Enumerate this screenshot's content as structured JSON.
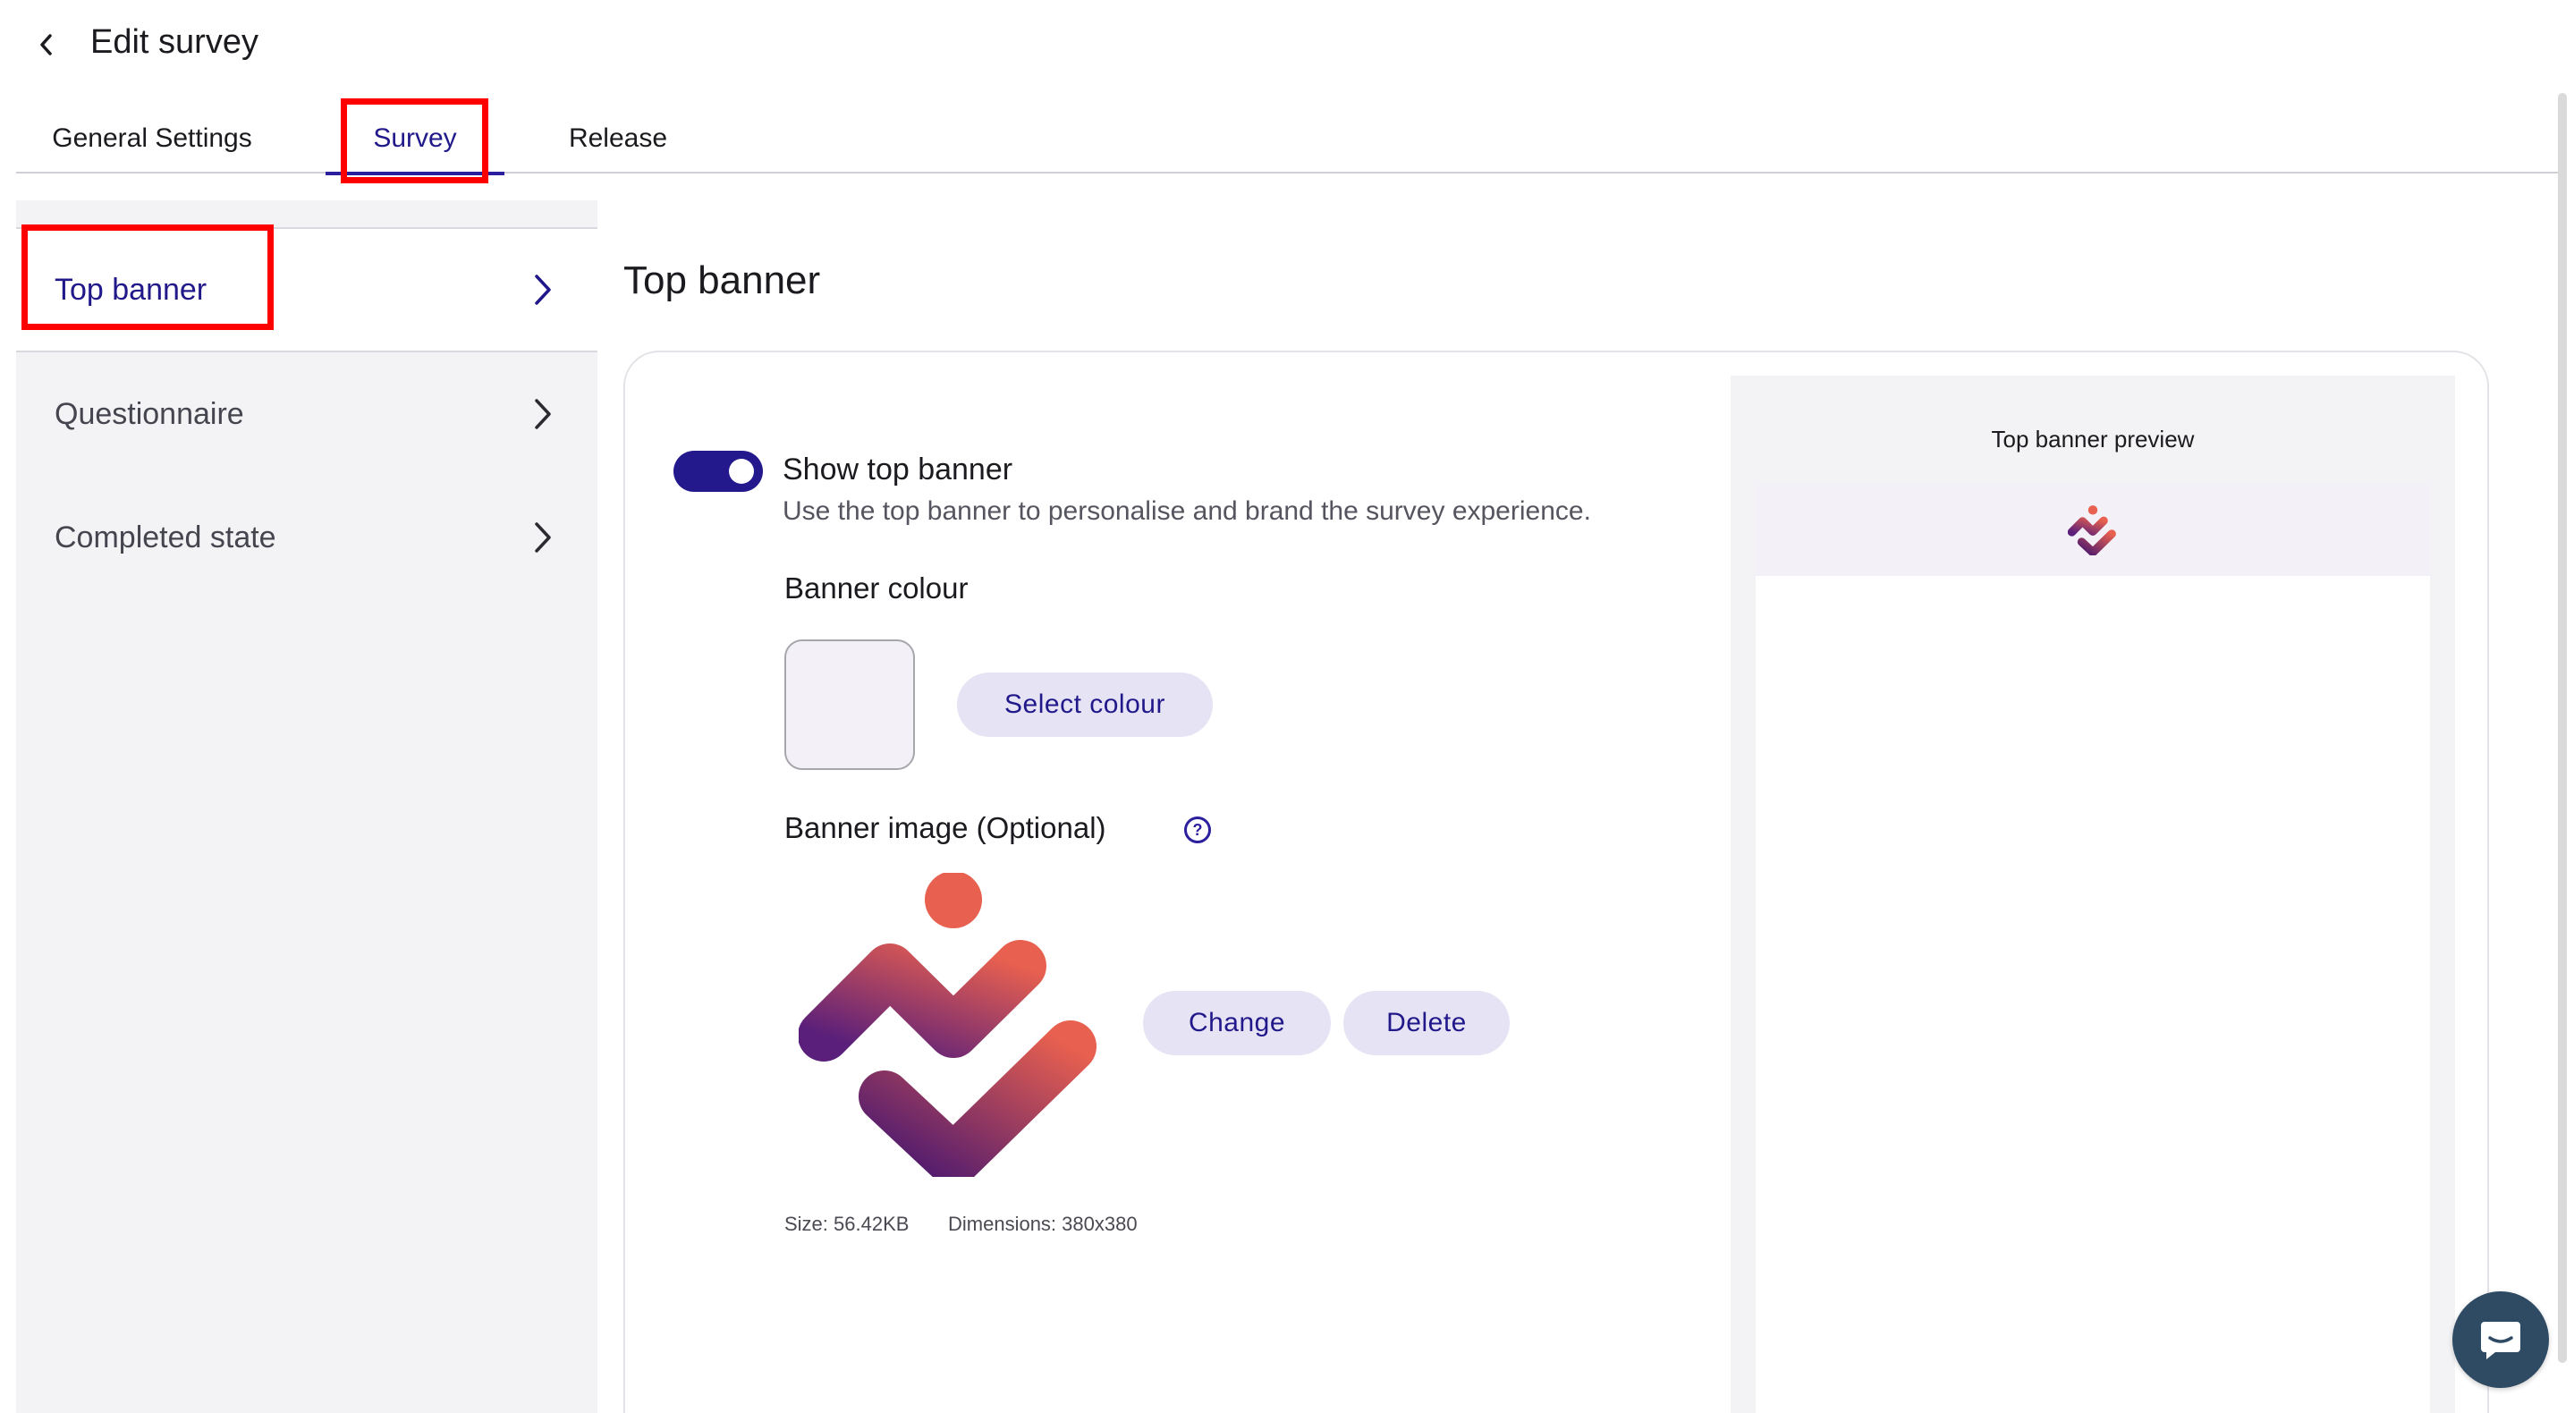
{
  "header": {
    "title": "Edit survey",
    "back_icon": "chevron-left-icon"
  },
  "tabs": [
    {
      "label": "General Settings",
      "active": false
    },
    {
      "label": "Survey",
      "active": true
    },
    {
      "label": "Release",
      "active": false
    }
  ],
  "sidebar": {
    "items": [
      {
        "label": "Top banner",
        "active": true,
        "icon": "chevron-right-icon"
      },
      {
        "label": "Questionnaire",
        "active": false,
        "icon": "chevron-right-icon"
      },
      {
        "label": "Completed state",
        "active": false,
        "icon": "chevron-right-icon"
      }
    ]
  },
  "main": {
    "title": "Top banner",
    "toggle": {
      "label": "Show top banner",
      "description": "Use the top banner to personalise and brand the survey experience.",
      "on": true
    },
    "banner_colour": {
      "title": "Banner colour",
      "swatch_color": "#f3f1f7",
      "select_label": "Select colour"
    },
    "banner_image": {
      "title": "Banner image (Optional)",
      "help_icon": "help-circle-icon",
      "change_label": "Change",
      "delete_label": "Delete",
      "size_text": "Size: 56.42KB",
      "dimensions_text": "Dimensions: 380x380"
    },
    "preview": {
      "title": "Top banner preview"
    }
  },
  "colors": {
    "accent": "#23188c",
    "highlight": "#ff0000",
    "pill_bg": "#e6e3f5",
    "logo_gradient_start": "#5a1f7a",
    "logo_gradient_end": "#e8604f"
  },
  "chat": {
    "icon": "chat-bubble-icon"
  }
}
